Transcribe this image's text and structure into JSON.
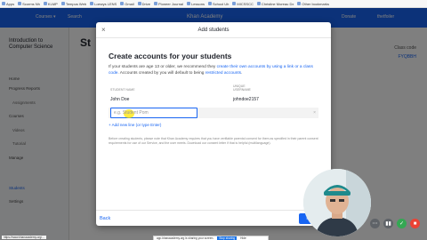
{
  "bookmarks": [
    "Apps",
    "Scorms Nh",
    "KLMP",
    "Tempus Web",
    "Loewys LENS",
    "Gmail",
    "Drive",
    "Pioneer Journal",
    "Lessons",
    "School Uh",
    "MICSSCC",
    "Christine Moreau Dx",
    "Other bookmarks"
  ],
  "app": {
    "header_items": [
      "Courses ▾",
      "Search",
      "Khan Academy",
      "Donate",
      "thetfoiler"
    ],
    "course_title": "Introduction to Computer Science",
    "course_title_bg": "St",
    "side_items": [
      "Home",
      "Progress Reports",
      "Assignments",
      "Courses",
      "Videos",
      "Tutorial",
      "Manage",
      "Students",
      "Settings"
    ],
    "class_code_label": "Class code",
    "class_code": "FYQBBH"
  },
  "modal": {
    "close": "×",
    "title": "Add students",
    "heading": "Create accounts for your students",
    "desc_1": "If your students are age 13 or older, we recommend they ",
    "desc_link_1": "create their own accounts by using a link or a class code",
    "desc_2": ". Accounts created by you will default to being ",
    "desc_link_2": "restricted accounts",
    "desc_3": ".",
    "col_student_name": "STUDENT NAME",
    "col_username_top": "UNIQUE",
    "col_username": "USERNAME",
    "row1_name": "John Doe",
    "row1_username": "johndoe2157",
    "input_placeholder": "e.g. Student Pom",
    "remove_icon": "×",
    "add_line": "+ Add new line (or type Enter)",
    "fine_print": "Before creating students, please note that Khan Academy requires that you have verifiable parental consent for them as specified in their parent consent requirements for use of our Service, and the user meets. Download our consent letter if that is helpful (multilanguage).",
    "back": "Back",
    "next": "Next"
  },
  "share": {
    "text": "app.khanacademy.org is sharing your screen.",
    "stop": "Stop sharing",
    "hide": "Hide"
  },
  "status_url": "https://www.khanacademy.org/...",
  "colors": {
    "accent": "#1865f2",
    "header": "#1865f2",
    "stop": "#ea4335",
    "ok": "#34a853"
  }
}
